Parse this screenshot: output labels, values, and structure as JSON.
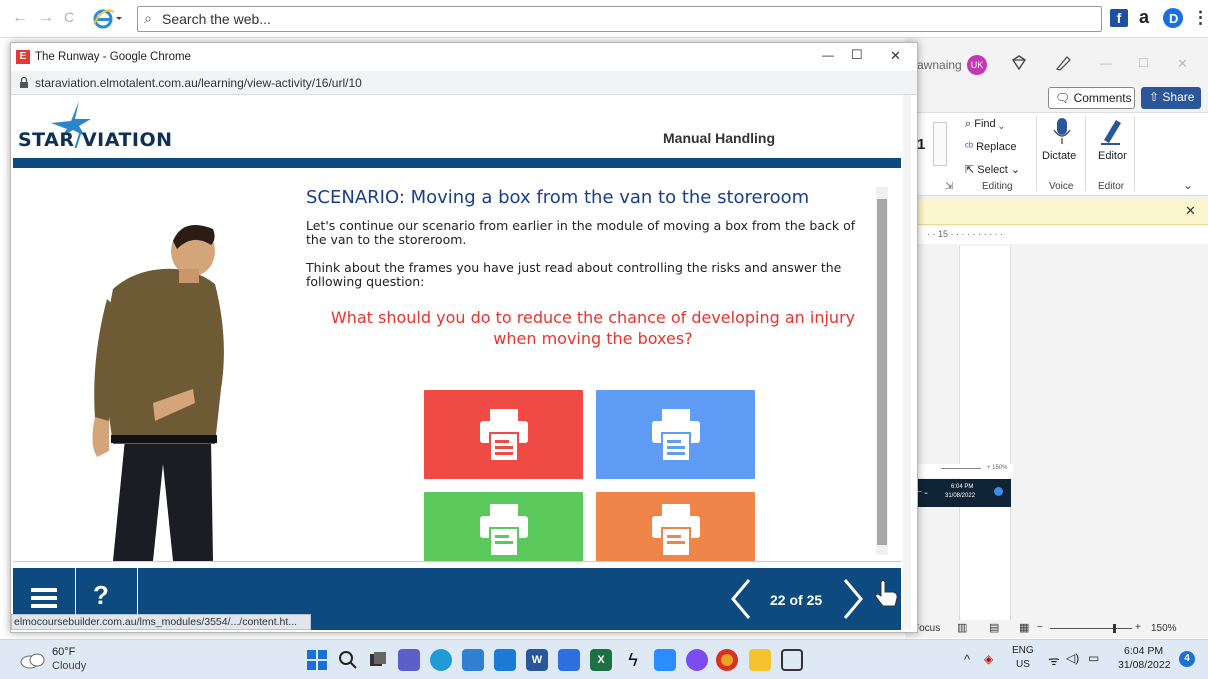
{
  "outer_browser": {
    "back_glyph": "←",
    "forward_glyph": "→",
    "reload_glyph": "C",
    "search_placeholder": "Search the web...",
    "ext_a": "a",
    "menu_glyph": "⋮"
  },
  "popup": {
    "title": "The Runway - Google Chrome",
    "url": "staraviation.elmotalent.com.au/learning/view-activity/16/url/10",
    "minimize": "—",
    "maximize": "☐",
    "close": "✕"
  },
  "course": {
    "logo_left": "STAR",
    "logo_right": "VIATION",
    "module_title": "Manual Handling",
    "scenario_title": "SCENARIO: Moving a box from the van to the storeroom",
    "paragraph1": "Let's continue our scenario from earlier in the module of moving a box from the back of the van to the storeroom.",
    "paragraph2": "Think about the frames you have just read about controlling the risks and answer the following question:",
    "question": "What should you do to reduce the chance of developing an injury when moving the boxes?",
    "tiles": [
      {
        "color": "#f04a45"
      },
      {
        "color": "#5e9cf5"
      },
      {
        "color": "#5ac85a"
      },
      {
        "color": "#f0854a"
      }
    ],
    "page_indicator": "22 of 25",
    "help_glyph": "?",
    "status_url": "elmocoursebuilder.com.au/lms_modules/3554/.../content.ht..."
  },
  "word": {
    "user_fragment": "awnaing",
    "user_initials": "UK",
    "comments_label": "Comments",
    "share_label": "Share",
    "find_label": "Find",
    "replace_label": "Replace",
    "select_label": "Select",
    "editing_label": "Editing",
    "dictate_label": "Dictate",
    "voice_label": "Voice",
    "editor_label": "Editor",
    "editor_group_label": "Editor",
    "ruler_text": "· · 15 · · · · · · · · · ·",
    "mini_zoom": "+ 150%",
    "mini_time": "6:04 PM",
    "mini_date": "31/08/2022",
    "focus_label": "Focus",
    "zoom_label": "150%",
    "font_size": "1"
  },
  "taskbar": {
    "temperature": "60°F",
    "weather": "Cloudy",
    "lang_top": "ENG",
    "lang_bottom": "US",
    "time": "6:04 PM",
    "date": "31/08/2022",
    "notification_count": "4"
  },
  "colors": {
    "course_blue": "#0c4a80",
    "scenario_blue": "#1a3e8c",
    "question_red": "#e8332f",
    "word_accent": "#2b579a"
  }
}
